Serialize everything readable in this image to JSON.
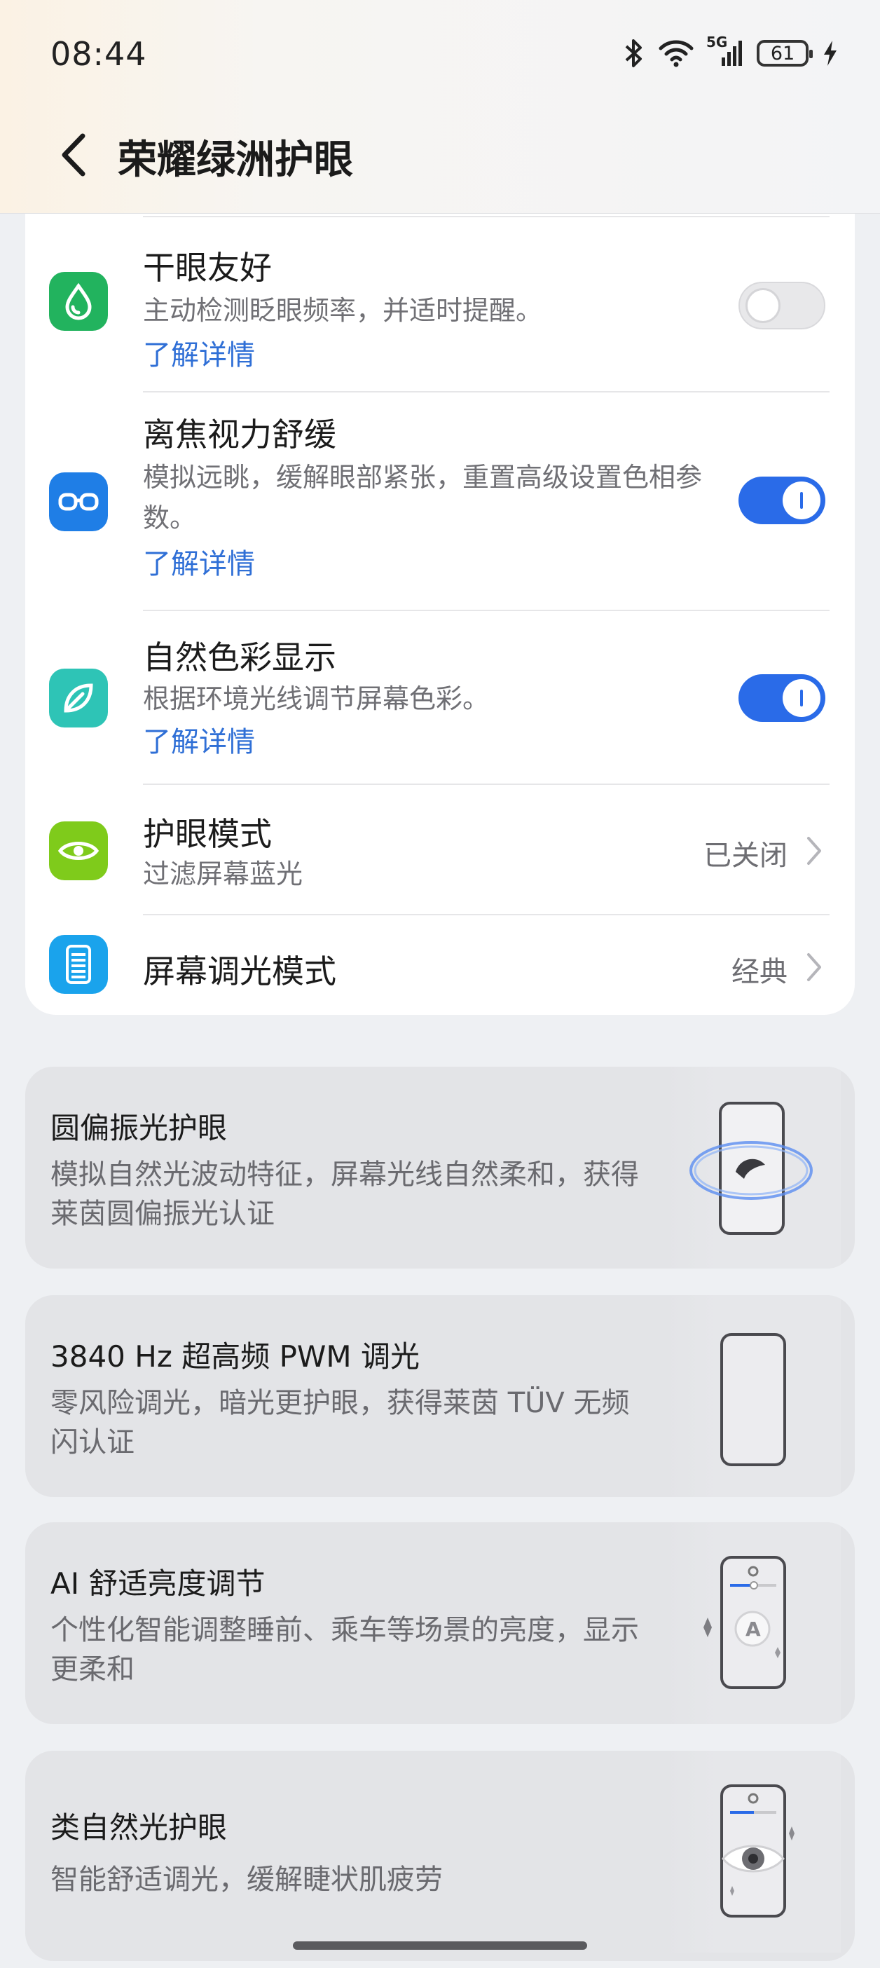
{
  "status_bar": {
    "time": "08:44",
    "network": "5G",
    "battery": "61"
  },
  "header": {
    "title": "荣耀绿洲护眼"
  },
  "settings": [
    {
      "title": "干眼友好",
      "desc": "主动检测眨眼频率，并适时提醒。",
      "link": "了解详情",
      "toggle": "off"
    },
    {
      "title": "离焦视力舒缓",
      "desc": "模拟远眺，缓解眼部紧张，重置高级设置色相参数。",
      "link": "了解详情",
      "toggle": "on"
    },
    {
      "title": "自然色彩显示",
      "desc": "根据环境光线调节屏幕色彩。",
      "link": "了解详情",
      "toggle": "on"
    },
    {
      "title": "护眼模式",
      "desc": "过滤屏幕蓝光",
      "value": "已关闭"
    },
    {
      "title": "屏幕调光模式",
      "value": "经典"
    }
  ],
  "features": [
    {
      "title": "圆偏振光护眼",
      "desc": "模拟自然光波动特征，屏幕光线自然柔和，获得莱茵圆偏振光认证"
    },
    {
      "title": "3840 Hz 超高频 PWM 调光",
      "desc": "零风险调光，暗光更护眼，获得莱茵 TÜV 无频闪认证"
    },
    {
      "title": "AI 舒适亮度调节",
      "desc": "个性化智能调整睡前、乘车等场景的亮度，显示更柔和"
    },
    {
      "title": "类自然光护眼",
      "desc": "智能舒适调光，缓解睫状肌疲劳"
    }
  ],
  "colors": {
    "accent": "#2a6be8",
    "link": "#2f6fd6",
    "icon_dry_eye": "#22b35e",
    "icon_defocus": "#1f7ee6",
    "icon_natural": "#2ec4b6",
    "icon_eye_mode": "#7fcb1b",
    "icon_dimming": "#1aa3ec"
  }
}
